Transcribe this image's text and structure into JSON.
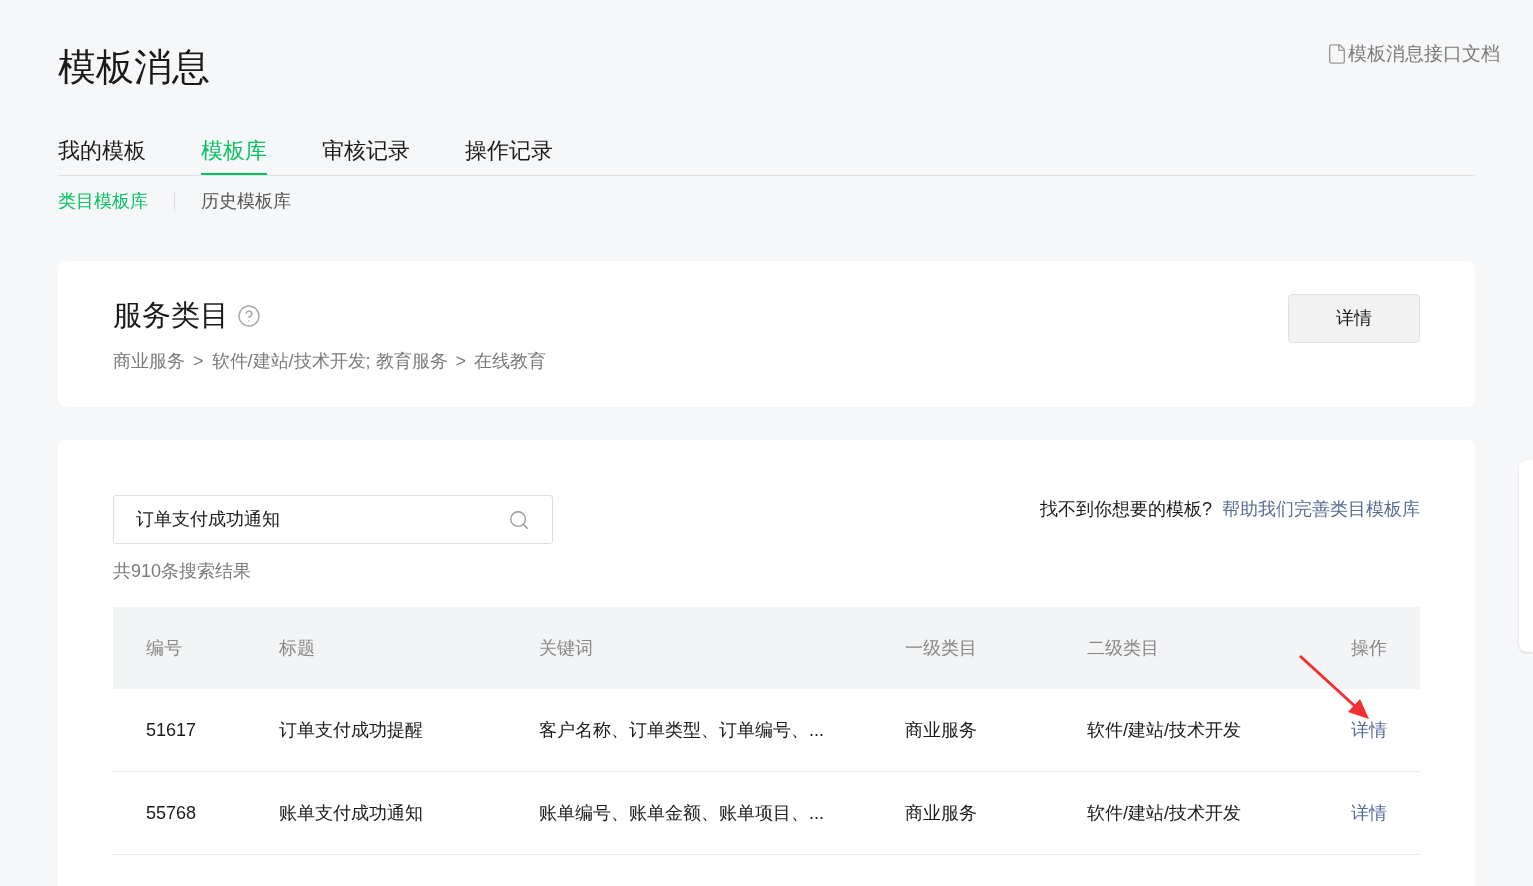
{
  "page": {
    "title": "模板消息",
    "doc_link": "模板消息接口文档"
  },
  "tabs": [
    {
      "label": "我的模板",
      "selected": false
    },
    {
      "label": "模板库",
      "selected": true
    },
    {
      "label": "审核记录",
      "selected": false
    },
    {
      "label": "操作记录",
      "selected": false
    }
  ],
  "subtabs": [
    {
      "label": "类目模板库",
      "selected": true
    },
    {
      "label": "历史模板库",
      "selected": false
    }
  ],
  "category": {
    "title": "服务类目",
    "breadcrumb": [
      "商业服务",
      "软件/建站/技术开发; 教育服务",
      "在线教育"
    ],
    "separator": ">",
    "button": "详情"
  },
  "search": {
    "value": "订单支付成功通知",
    "result_count": "共910条搜索结果",
    "hint": "找不到你想要的模板?",
    "hint_link": "帮助我们完善类目模板库"
  },
  "table": {
    "columns": [
      "编号",
      "标题",
      "关键词",
      "一级类目",
      "二级类目",
      "操作"
    ],
    "rows": [
      {
        "id": "51617",
        "title": "订单支付成功提醒",
        "keywords": "客户名称、订单类型、订单编号、...",
        "category_1": "商业服务",
        "category_2": "软件/建站/技术开发",
        "action": "详情"
      },
      {
        "id": "55768",
        "title": "账单支付成功通知",
        "keywords": "账单编号、账单金额、账单项目、...",
        "category_1": "商业服务",
        "category_2": "软件/建站/技术开发",
        "action": "详情"
      }
    ]
  }
}
